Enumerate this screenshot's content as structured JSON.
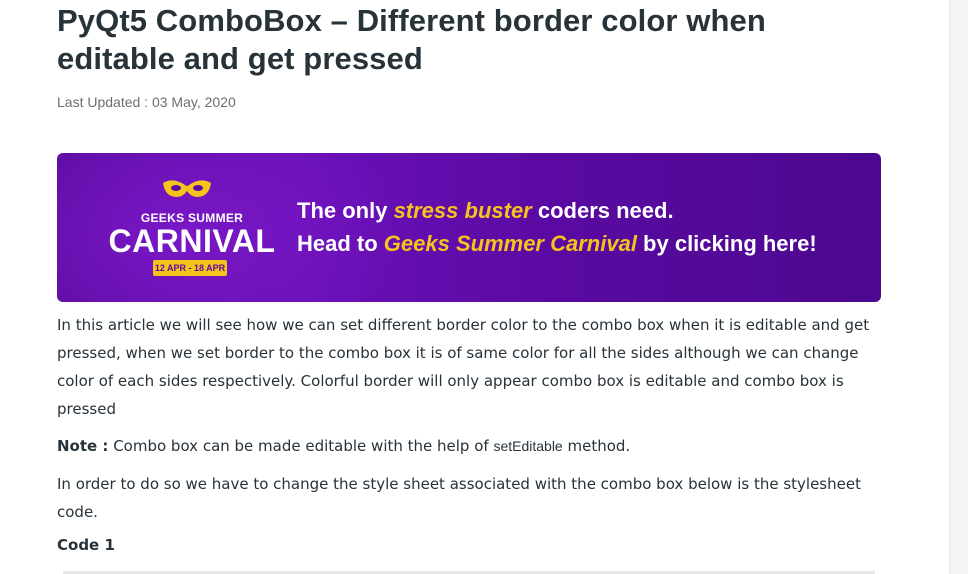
{
  "article": {
    "title": "PyQt5 ComboBox – Different border color when editable and get pressed",
    "last_updated": "Last Updated : 03 May, 2020"
  },
  "banner": {
    "logo_small": "GEEKS SUMMER",
    "logo_big": "CARNIVAL",
    "logo_dates": "12 APR - 18 APR",
    "line1_a": "The only ",
    "line1_hl": "stress buster",
    "line1_b": " coders need.",
    "line2_a": "Head to ",
    "line2_hl": "Geeks Summer Carnival",
    "line2_b": " by clicking here!",
    "colors": {
      "bg": "#5b0b9e",
      "accent": "#f6c21c"
    }
  },
  "content": {
    "p1": "In this article we will see how we can set different border color to the combo box when it is editable and get pressed, when we set border to the combo box it is of same color for all the sides although we can change color of each sides respectively. Colorful border will only appear combo box is editable and combo box is pressed",
    "note_label": "Note :",
    "note_text_a": " Combo box can be made editable with the help of ",
    "note_code": "setEditable",
    "note_text_b": " method.",
    "p3": "In order to do so we have to change the style sheet associated with the combo box below is the stylesheet code.",
    "code_label": "Code 1"
  }
}
